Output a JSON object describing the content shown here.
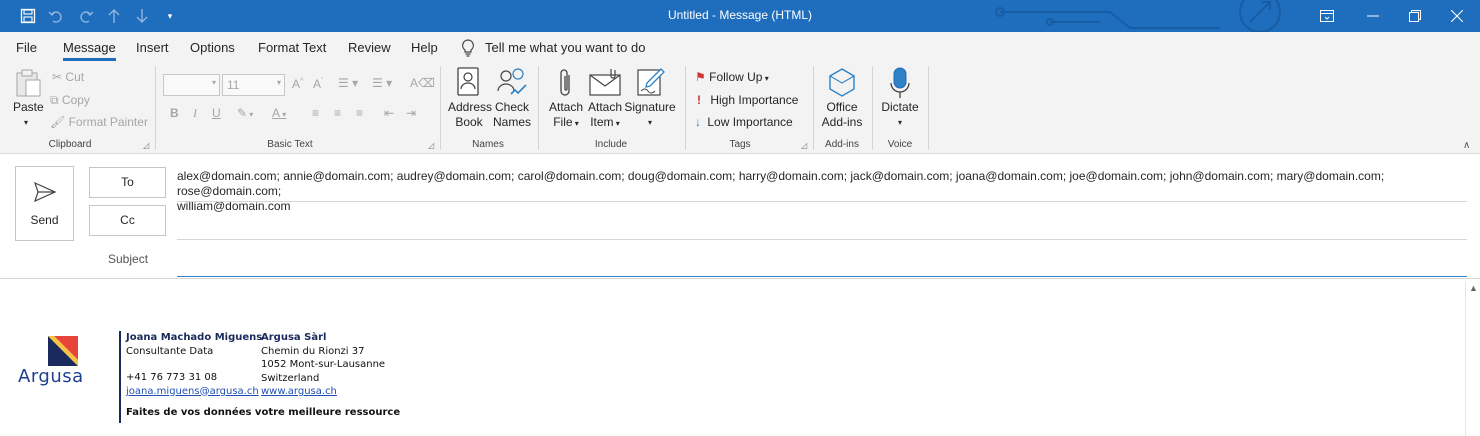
{
  "window": {
    "title": "Untitled  -  Message (HTML)"
  },
  "menu": {
    "tabs": [
      "File",
      "Message",
      "Insert",
      "Options",
      "Format Text",
      "Review",
      "Help"
    ],
    "active_tab": "Message",
    "tell_me": "Tell me what you want to do"
  },
  "ribbon": {
    "clipboard": {
      "paste": "Paste",
      "cut": "Cut",
      "copy": "Copy",
      "format_painter": "Format Painter",
      "label": "Clipboard"
    },
    "basic_text": {
      "font_size": "11",
      "label": "Basic Text",
      "bold": "B",
      "italic": "I",
      "underline": "U"
    },
    "names": {
      "address_book_1": "Address",
      "address_book_2": "Book",
      "check_names_1": "Check",
      "check_names_2": "Names",
      "label": "Names"
    },
    "include": {
      "attach_file_1": "Attach",
      "attach_file_2": "File",
      "attach_item_1": "Attach",
      "attach_item_2": "Item",
      "signature": "Signature",
      "label": "Include"
    },
    "tags": {
      "follow_up": "Follow Up",
      "high_importance": "High Importance",
      "low_importance": "Low Importance",
      "label": "Tags"
    },
    "addins": {
      "office_addins_1": "Office",
      "office_addins_2": "Add-ins",
      "label": "Add-ins"
    },
    "voice": {
      "dictate": "Dictate",
      "label": "Voice"
    }
  },
  "compose": {
    "send": "Send",
    "to": "To",
    "cc": "Cc",
    "subject_label": "Subject",
    "recipients_line1": "alex@domain.com; annie@domain.com; audrey@domain.com; carol@domain.com; doug@domain.com; harry@domain.com; jack@domain.com; joana@domain.com; joe@domain.com; john@domain.com; mary@domain.com; rose@domain.com;",
    "recipients_line2": "william@domain.com",
    "cc_value": "",
    "subject_value": ""
  },
  "signature": {
    "logo": "Argusa",
    "name": "Joana Machado Miguens",
    "role": "Consultante Data",
    "phone": "+41 76 773 31 08",
    "email": "joana.miguens@argusa.ch",
    "company": "Argusa Sàrl",
    "street": "Chemin du Rionzi 37",
    "city": "1052 Mont-sur-Lausanne",
    "country": "Switzerland",
    "website": "www.argusa.ch",
    "tagline": "Faites de vos données votre meilleure ressource"
  },
  "colors": {
    "titlebar": "#1f6dbd",
    "ribbon": "#f3f3f3",
    "accent": "#2f82c6",
    "brand_navy": "#1a2a5c"
  }
}
